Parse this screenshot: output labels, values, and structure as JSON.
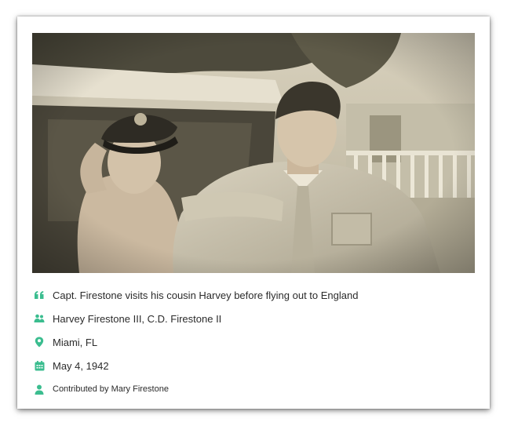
{
  "accent_color": "#3bbd8f",
  "photo": {
    "icon": "photo-image",
    "tone": "sepia"
  },
  "details": {
    "caption": {
      "icon": "quote-icon",
      "text": "Capt. Firestone visits his cousin Harvey before flying out to England"
    },
    "people": {
      "icon": "people-icon",
      "text": "Harvey Firestone III, C.D. Firestone II"
    },
    "location": {
      "icon": "location-pin-icon",
      "text": "Miami, FL"
    },
    "date": {
      "icon": "calendar-icon",
      "text": "May 4, 1942"
    },
    "contributor": {
      "icon": "person-icon",
      "text": "Contributed by Mary Firestone"
    }
  }
}
